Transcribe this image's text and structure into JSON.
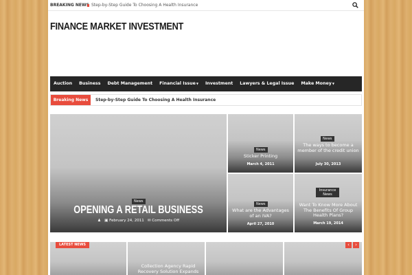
{
  "topbar": {
    "breaking_label": "BREAKING NEWS",
    "breaking_text": "Step-by-Step Guide To Choosing A Health Insurance",
    "search_icon": "search-icon"
  },
  "site": {
    "title": "FINANCE MARKET INVESTMENT"
  },
  "nav": {
    "items": [
      {
        "label": "Auction"
      },
      {
        "label": "Business"
      },
      {
        "label": "Debt Management"
      },
      {
        "label": "Financial Issue",
        "caret": "▼"
      },
      {
        "label": "Investment"
      },
      {
        "label": "Lawyers & Legal Issue"
      },
      {
        "label": "Make Money",
        "caret": "▼"
      }
    ]
  },
  "breaking": {
    "label": "Breaking News",
    "text": "Step-by-Step Guide To Choosing A Health Insurance"
  },
  "featured": {
    "main": {
      "badge": "News",
      "title": "OPENING A RETAIL BUSINESS",
      "date": "February 24, 2011",
      "comments": "Comments Off"
    },
    "tiles": [
      {
        "badge": "News",
        "title": "Sticker Printing",
        "date": "March 4, 2011"
      },
      {
        "badge": "News",
        "title": "The ways to become a member of the credit union",
        "date": "July 30, 2013"
      },
      {
        "badge": "News",
        "title": "What are the Advantages of an IVA?",
        "date": "April 27, 2010"
      },
      {
        "badge_line1": "Insurance",
        "badge_line2": "News",
        "title": "Want To Know More About The Benefits Of Group Health Plans?",
        "date": "March 19, 2014"
      }
    ]
  },
  "latest": {
    "label": "LATEST NEWS",
    "prev": "‹",
    "next": "›",
    "visible_title": "Collection Agency Rapid Recovery Solution Expands"
  },
  "colors": {
    "accent": "#e84c3d",
    "nav_bg": "#262626",
    "page_bg_wood": "#d9a865"
  }
}
